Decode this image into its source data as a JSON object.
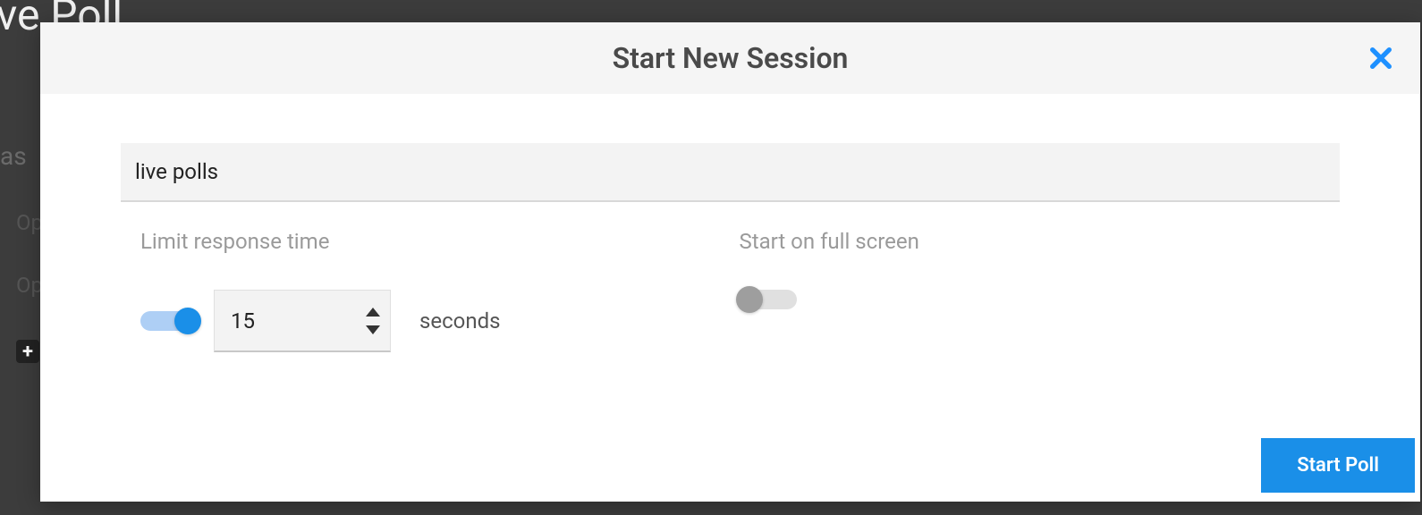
{
  "background": {
    "title_fragment": "ve Poll",
    "as_text": "as",
    "op1": "Op",
    "op2": "Op"
  },
  "modal": {
    "title": "Start New Session",
    "name_value": "live polls",
    "limit_time": {
      "label": "Limit response time",
      "enabled": true,
      "value": "15",
      "unit": "seconds"
    },
    "fullscreen": {
      "label": "Start on full screen",
      "enabled": false
    },
    "start_button": "Start Poll"
  }
}
